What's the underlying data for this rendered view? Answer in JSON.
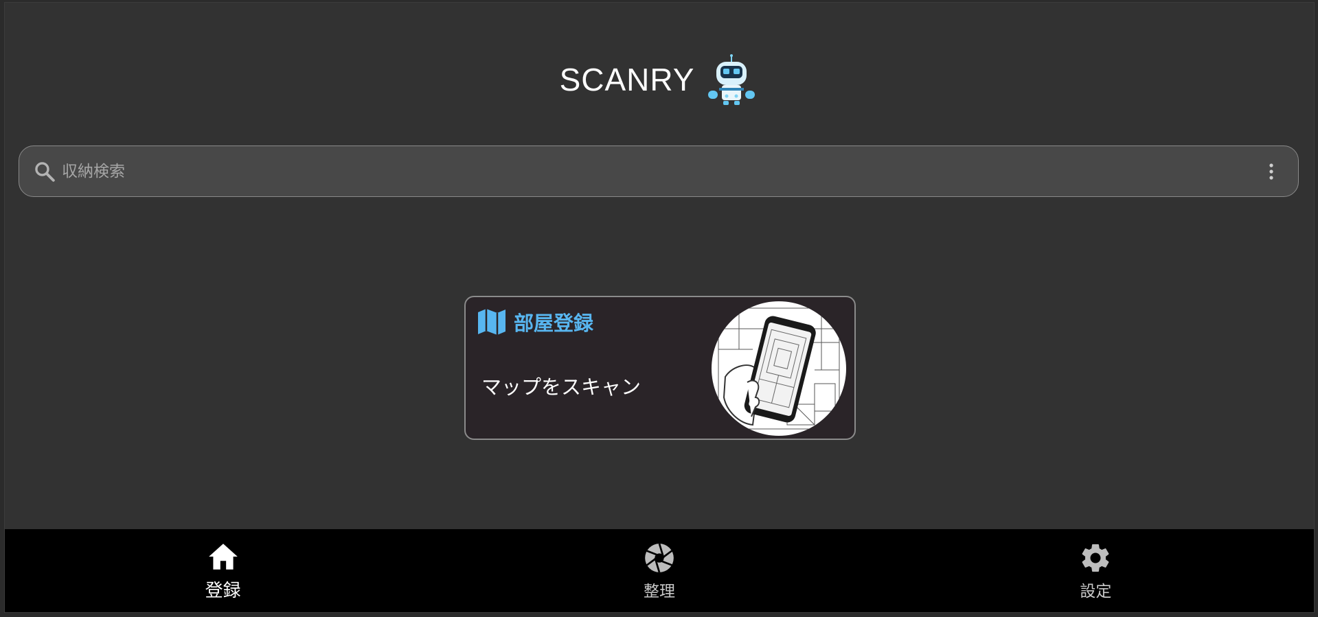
{
  "header": {
    "title": "SCANRY",
    "logo_icon": "robot-icon"
  },
  "search": {
    "placeholder": "収納検索",
    "value": "",
    "icon": "search-icon",
    "menu_icon": "more-vert-icon"
  },
  "card": {
    "icon": "map-icon",
    "title": "部屋登録",
    "subtitle": "マップをスキャン",
    "image": "phone-scanning-room-illustration",
    "accent_color": "#58b6f0"
  },
  "nav": {
    "items": [
      {
        "label": "登録",
        "icon": "home-icon",
        "active": true
      },
      {
        "label": "整理",
        "icon": "aperture-icon",
        "active": false
      },
      {
        "label": "設定",
        "icon": "gear-icon",
        "active": false
      }
    ]
  }
}
